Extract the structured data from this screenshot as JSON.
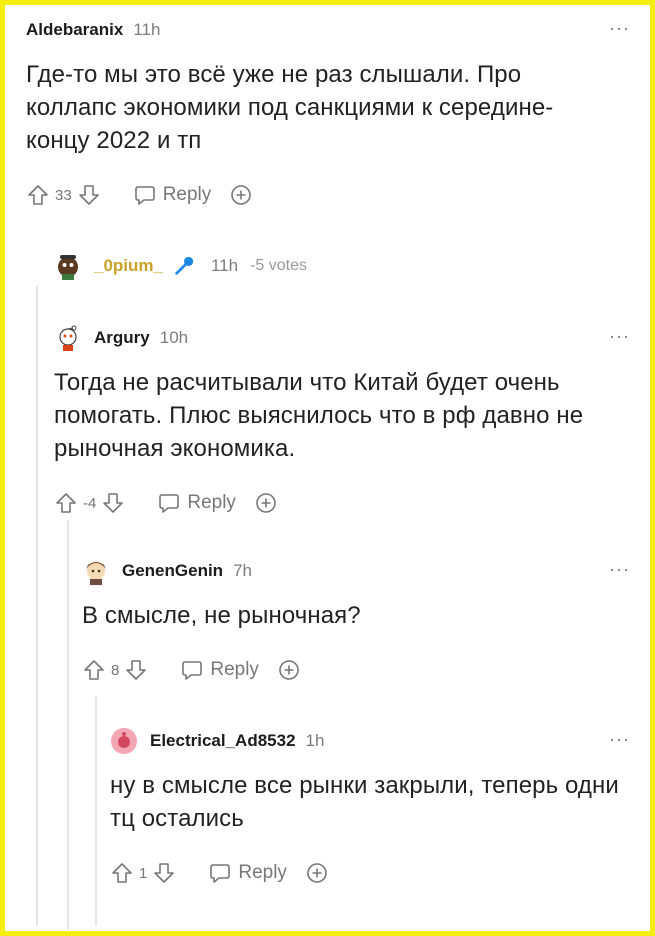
{
  "comments": [
    {
      "username": "Aldebaranix",
      "time": "11h",
      "more": "···",
      "body": "Где-то мы это всё уже не раз слышали. Про коллапс экономики под санкциями к середине-концу 2022 и тп",
      "score": "33",
      "reply_label": "Reply"
    },
    {
      "username": "_0pium_",
      "time": "11h",
      "votes": "-5 votes"
    },
    {
      "username": "Argury",
      "time": "10h",
      "more": "···",
      "body": "Тогда не расчитывали что Китай будет очень помогать. Плюс выяснилось что в рф давно не рыночная экономика.",
      "score": "-4",
      "reply_label": "Reply"
    },
    {
      "username": "GenenGenin",
      "time": "7h",
      "more": "···",
      "body": "В смысле, не рыночная?",
      "score": "8",
      "reply_label": "Reply"
    },
    {
      "username": "Electrical_Ad8532",
      "time": "1h",
      "more": "···",
      "body": "ну в смысле все рынки закрыли, теперь одни тц остались",
      "score": "1",
      "reply_label": "Reply"
    }
  ],
  "colors": {
    "frame": "#f5ee12",
    "username_collapsed": "#c9a227",
    "mic": "#1e88e5"
  }
}
